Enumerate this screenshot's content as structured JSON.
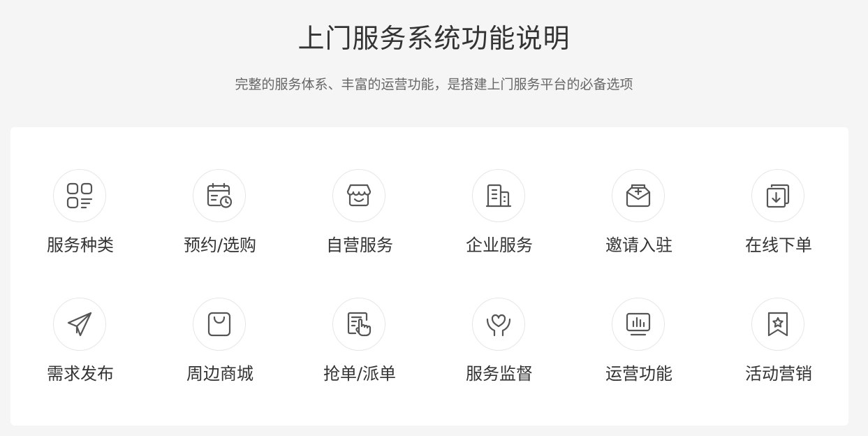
{
  "header": {
    "title": "上门服务系统功能说明",
    "subtitle": "完整的服务体系、丰富的运营功能，是搭建上门服务平台的必备选项"
  },
  "features": [
    {
      "label": "服务种类",
      "icon": "category-icon"
    },
    {
      "label": "预约/选购",
      "icon": "calendar-clock-icon"
    },
    {
      "label": "自营服务",
      "icon": "storefront-icon"
    },
    {
      "label": "企业服务",
      "icon": "building-icon"
    },
    {
      "label": "邀请入驻",
      "icon": "envelope-plus-icon"
    },
    {
      "label": "在线下单",
      "icon": "download-order-icon"
    },
    {
      "label": "需求发布",
      "icon": "paper-plane-icon"
    },
    {
      "label": "周边商城",
      "icon": "shopping-bag-icon"
    },
    {
      "label": "抢单/派单",
      "icon": "tap-order-icon"
    },
    {
      "label": "服务监督",
      "icon": "heart-hands-icon"
    },
    {
      "label": "运营功能",
      "icon": "monitor-chart-icon"
    },
    {
      "label": "活动营销",
      "icon": "star-bookmark-icon"
    }
  ],
  "colors": {
    "background": "#f5f5f5",
    "card": "#ffffff",
    "icon_stroke": "#555555",
    "circle_border": "#e6e6e6",
    "text": "#333333",
    "subtext": "#666666"
  }
}
